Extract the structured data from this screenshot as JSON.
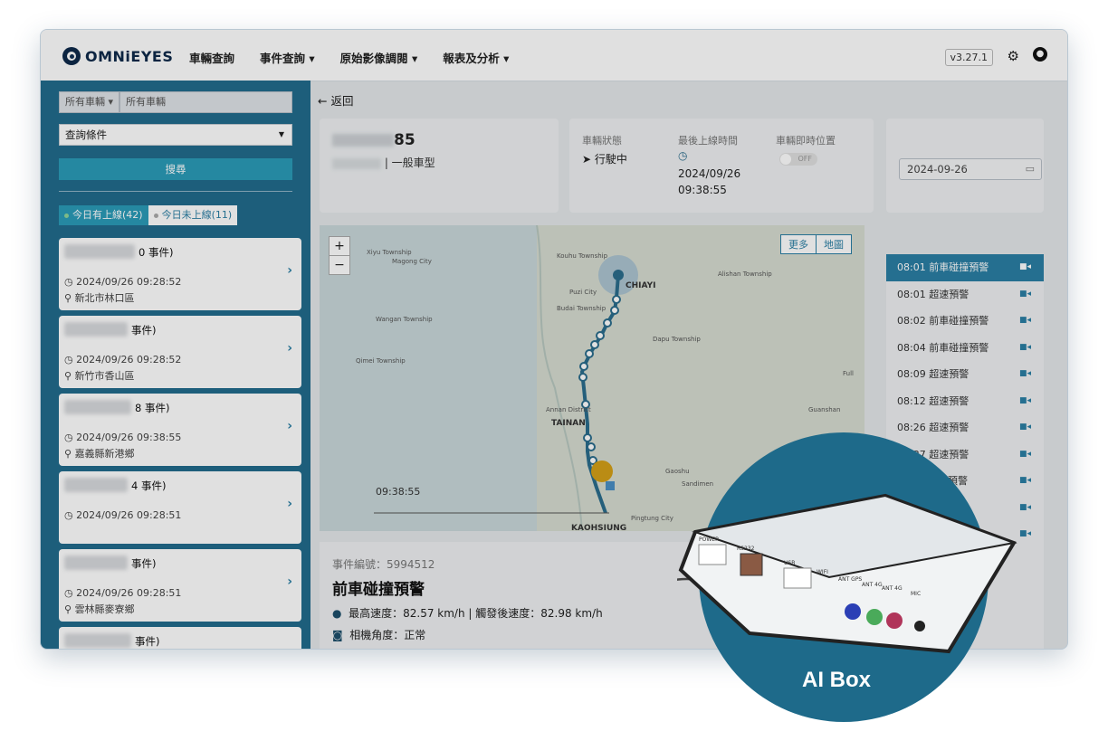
{
  "brand": {
    "logo_text": "OMNiEYES"
  },
  "nav": {
    "items": [
      "車輛查詢",
      "事件查詢 ▾",
      "原始影像調閱 ▾",
      "報表及分析 ▾"
    ]
  },
  "version": "v3.27.1",
  "sidebar": {
    "vehicle_select": "所有車輛 ▾",
    "vehicle_placeholder": "所有車輛",
    "query_select": "查詢條件",
    "search_button": "搜尋",
    "tabs": {
      "online": "今日有上線(42)",
      "offline": "今日未上線(11)"
    },
    "cards": [
      {
        "name": "0 事件)",
        "time": "2024/09/26 09:28:52",
        "loc": "新北市林口區"
      },
      {
        "name": "事件)",
        "time": "2024/09/26 09:28:52",
        "loc": "新竹市香山區"
      },
      {
        "name": "8 事件)",
        "time": "2024/09/26 09:38:55",
        "loc": "嘉義縣新港鄉"
      },
      {
        "name": "4 事件)",
        "time": "2024/09/26 09:28:51",
        "loc": ""
      },
      {
        "name": "事件)",
        "time": "2024/09/26 09:28:51",
        "loc": "雲林縣麥寮鄉"
      },
      {
        "name": "事件)",
        "time": "",
        "loc": ""
      }
    ]
  },
  "main": {
    "back": "← 返回",
    "vehicle": {
      "plate_suffix": "85",
      "type": "| 一般車型"
    },
    "status": {
      "state_label": "車輛狀態",
      "state_value": "行駛中",
      "last_online_label": "最後上線時間",
      "last_online_date": "2024/09/26",
      "last_online_time": "09:38:55",
      "realtime_label": "車輛即時位置",
      "toggle": "OFF"
    },
    "date": "2024-09-26",
    "map": {
      "more": "更多",
      "map": "地圖",
      "time": "09:38:55",
      "labels": [
        "Xiyu Township",
        "Magong City",
        "Kouhu Township",
        "CHIAYI",
        "Alishan Township",
        "Puzi City",
        "Budai Township",
        "Wangan Township",
        "Dapu Township",
        "Qimei Township",
        "Annan District",
        "TAINAN",
        "Guanshan",
        "Gaoshu",
        "Sandimen",
        "Pingtung City",
        "KAOHSIUNG",
        "Full"
      ]
    },
    "events": [
      "08:01 前車碰撞預警",
      "08:01 超速預警",
      "08:02 前車碰撞預警",
      "08:04 前車碰撞預警",
      "08:09 超速預警",
      "08:12 超速預警",
      "08:26 超速預警",
      "08:37 超速預警",
      "超速預警",
      "預警",
      ""
    ],
    "detail": {
      "number": "事件編號：5994512",
      "title": "前車碰撞預警",
      "speed": "最高速度：82.57 km/h | 觸發後速度：82.98 km/h",
      "camera": "相機角度：正常"
    }
  },
  "aibox": {
    "label": "AI Box",
    "ports": [
      "POWER",
      "RS232",
      "USB",
      "WIFI",
      "ANT GPS",
      "ANT 4G",
      "ANT 4G",
      "MIC"
    ]
  }
}
